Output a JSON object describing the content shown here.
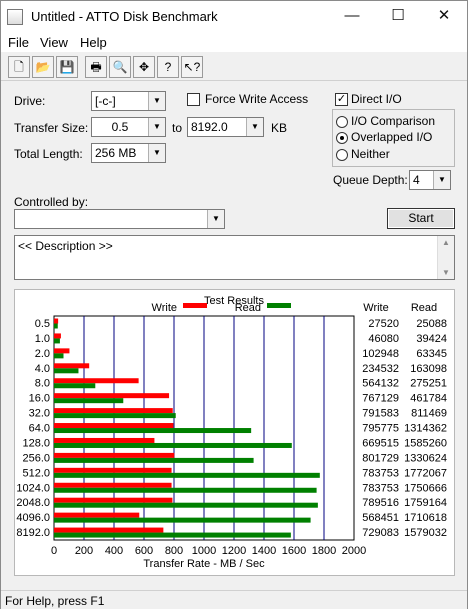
{
  "window": {
    "title": "Untitled - ATTO Disk Benchmark",
    "minimize": "—",
    "maximize": "☐",
    "close": "✕"
  },
  "menu": [
    "File",
    "View",
    "Help"
  ],
  "toolbar": [
    {
      "name": "new-file-icon",
      "glyph": "🗋"
    },
    {
      "name": "open-folder-icon",
      "glyph": "📂"
    },
    {
      "name": "save-icon",
      "glyph": "💾"
    },
    {
      "name": "print-icon",
      "glyph": "🖶"
    },
    {
      "name": "print-preview-icon",
      "glyph": "🔍"
    },
    {
      "name": "move-icon",
      "glyph": "✥"
    },
    {
      "name": "help-icon",
      "glyph": "?"
    },
    {
      "name": "context-help-icon",
      "glyph": "↖?"
    }
  ],
  "settings": {
    "drive_label": "Drive:",
    "drive_value": "[-c-]",
    "transfer_size_label": "Transfer Size:",
    "transfer_from": "0.5",
    "to_label": "to",
    "transfer_to": "8192.0",
    "kb_label": "KB",
    "total_length_label": "Total Length:",
    "total_length_value": "256 MB",
    "force_write_label": "Force Write Access",
    "force_write_checked": false,
    "direct_io_label": "Direct I/O",
    "direct_io_checked": true,
    "io_comparison_label": "I/O Comparison",
    "overlapped_io_label": "Overlapped I/O",
    "neither_label": "Neither",
    "io_mode_selected": "overlapped",
    "queue_depth_label": "Queue Depth:",
    "queue_depth_value": "4",
    "controlled_by_label": "Controlled by:",
    "controlled_by_value": "",
    "start_label": "Start"
  },
  "description": "<< Description >>",
  "results": {
    "title": "Test Results",
    "legend_write": "Write",
    "legend_read": "Read",
    "col_write": "Write",
    "col_read": "Read",
    "write_color": "#ff0000",
    "read_color": "#008000"
  },
  "chart_data": {
    "type": "bar",
    "orientation": "horizontal",
    "categories": [
      "0.5",
      "1.0",
      "2.0",
      "4.0",
      "8.0",
      "16.0",
      "32.0",
      "64.0",
      "128.0",
      "256.0",
      "512.0",
      "1024.0",
      "2048.0",
      "4096.0",
      "8192.0"
    ],
    "series": [
      {
        "name": "Write",
        "values": [
          27520,
          46080,
          102948,
          234532,
          564132,
          767129,
          791583,
          795775,
          669515,
          801729,
          783753,
          783753,
          789516,
          568451,
          729083
        ]
      },
      {
        "name": "Read",
        "values": [
          25088,
          39424,
          63345,
          163098,
          275251,
          461784,
          811469,
          1314362,
          1585260,
          1330624,
          1772067,
          1750666,
          1759164,
          1710618,
          1579032
        ]
      }
    ],
    "xlabel": "Transfer Rate - MB / Sec",
    "xlim": [
      0,
      2000
    ],
    "xticks": [
      "0",
      "200",
      "400",
      "600",
      "800",
      "1000",
      "1200",
      "1400",
      "1600",
      "1800",
      "2000"
    ],
    "legend": "top"
  },
  "status": "For Help, press F1"
}
